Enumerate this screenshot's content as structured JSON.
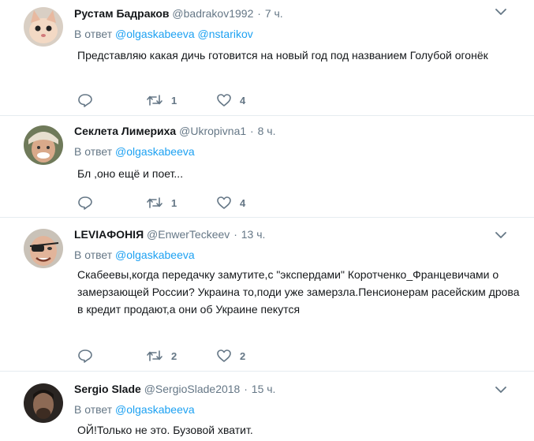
{
  "tweets": [
    {
      "name": "Рустам Бадраков",
      "handle": "@badrakov1992",
      "time": "7 ч.",
      "reply_prefix": "В ответ",
      "mentions": [
        "@olgaskabeeva",
        "@nstarikov"
      ],
      "text": "Представляю какая дичь готовится на новый год под названием Голубой огонёк",
      "replies": "",
      "retweets": "1",
      "likes": "4"
    },
    {
      "name": "Секлета Лимериха",
      "handle": "@Ukropivna1",
      "time": "8 ч.",
      "reply_prefix": "В ответ",
      "mentions": [
        "@olgaskabeeva"
      ],
      "text": "Бл  ,оно ещё и поет...",
      "replies": "",
      "retweets": "1",
      "likes": "4"
    },
    {
      "name": "LEVIAФОНІЯ",
      "handle": "@EnwerTeckeev",
      "time": "13 ч.",
      "reply_prefix": "В ответ",
      "mentions": [
        "@olgaskabeeva"
      ],
      "text": "Скабеевы,когда передачку замутите,с \"экспердами\" Коротченко_Францевичами о замерзающей России? Украина то,поди уже замерзла.Пенсионерам расейским дрова в кредит продают,а они об Украине пекутся",
      "replies": "",
      "retweets": "2",
      "likes": "2"
    },
    {
      "name": "Sergio Slade",
      "handle": "@SergioSlade2018",
      "time": "15 ч.",
      "reply_prefix": "В ответ",
      "mentions": [
        "@olgaskabeeva"
      ],
      "text": "ОЙ!Только не это. Бузовой хватит."
    }
  ],
  "colors": {
    "link": "#1da1f2",
    "muted": "#657786",
    "text": "#14171a",
    "divider": "#e6ecf0"
  }
}
